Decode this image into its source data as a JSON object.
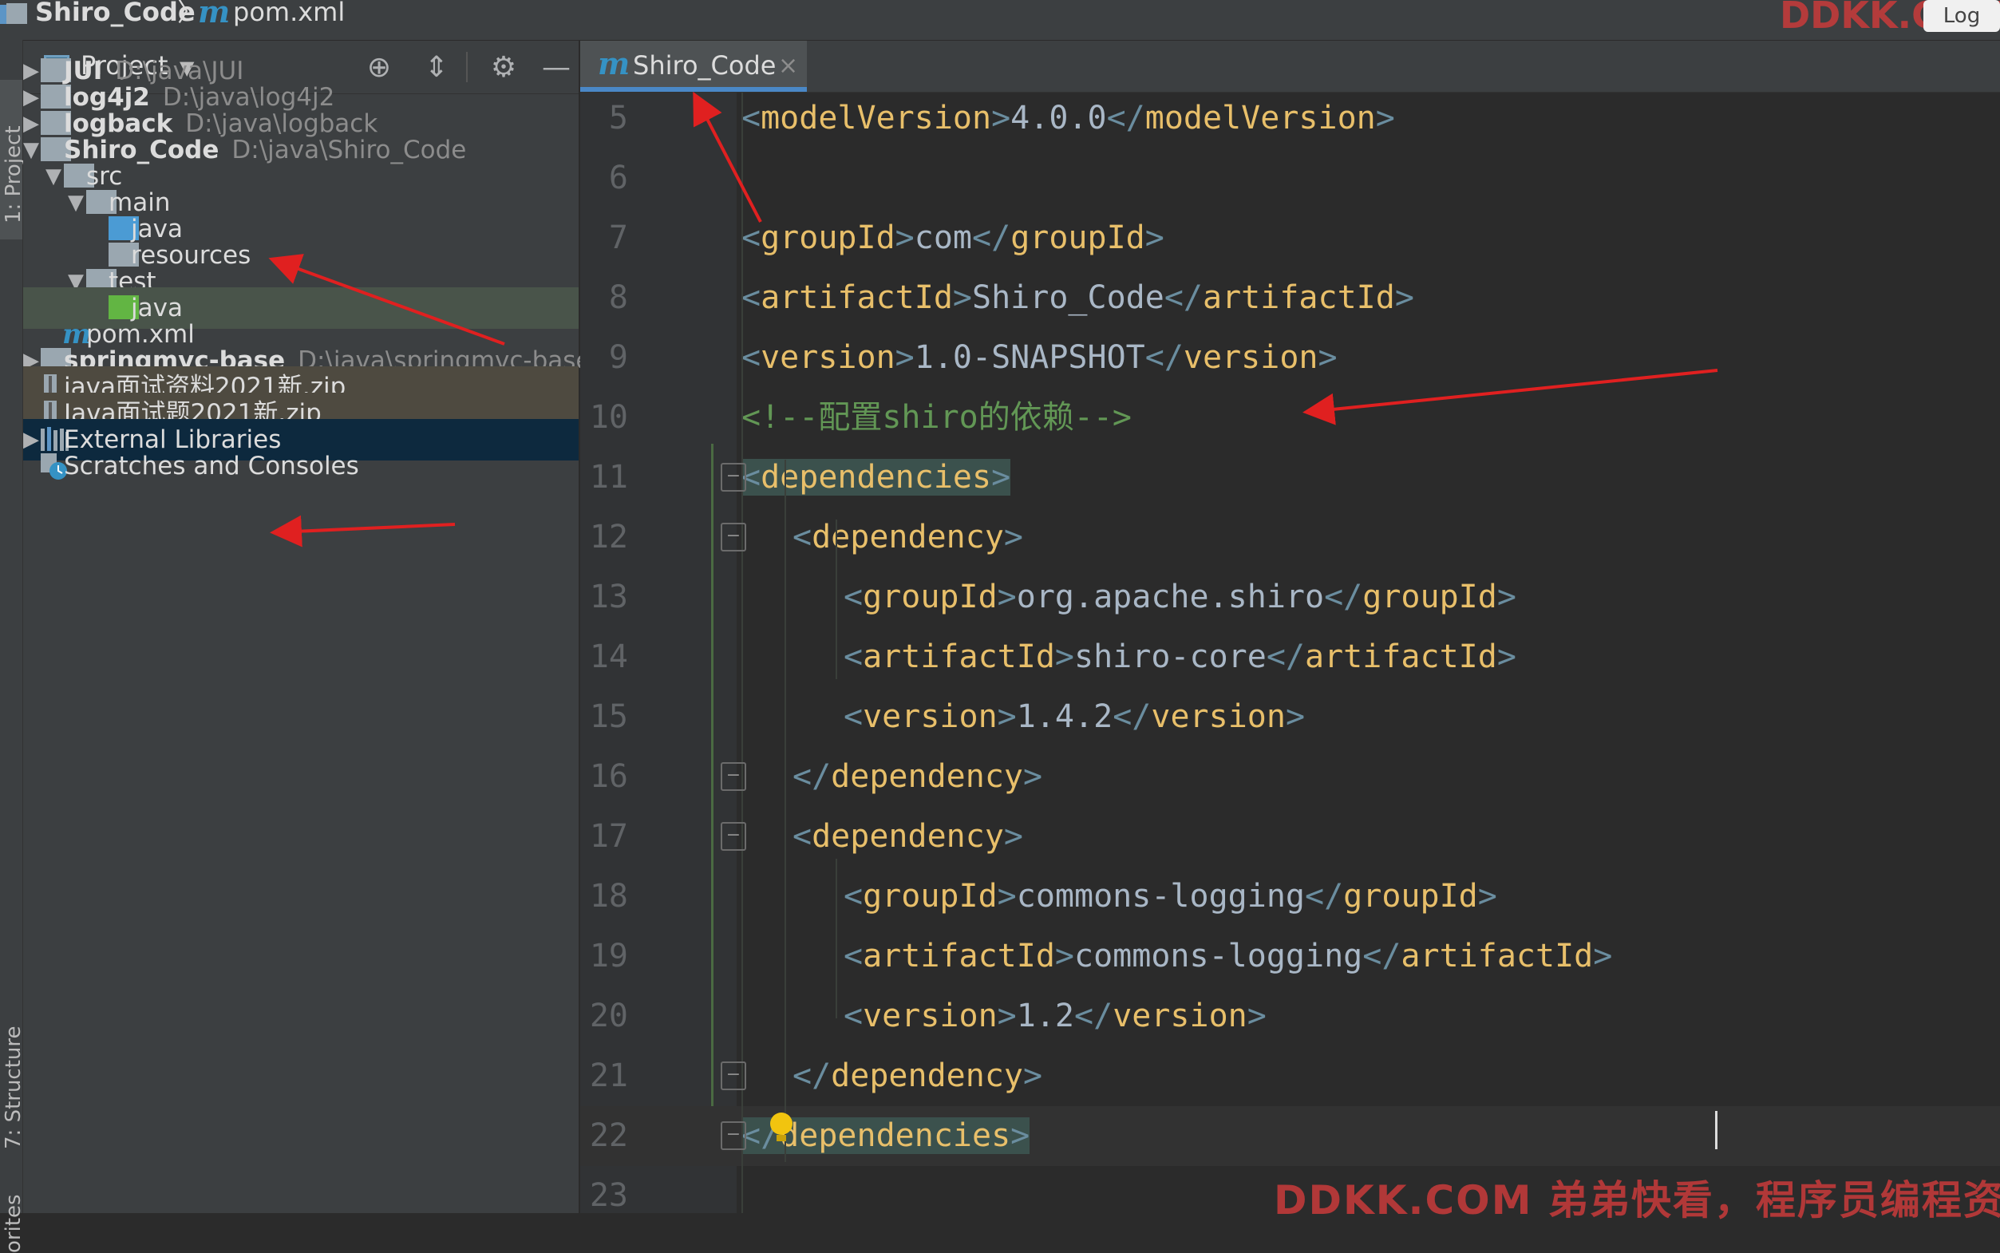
{
  "breadcrumb": {
    "project": "Shiro_Code",
    "separator": "〉",
    "file": "pom.xml"
  },
  "left_strip": {
    "project_tab": "1: Project",
    "structure_tab": "7: Structure",
    "favorites_tab": "orites"
  },
  "project_panel": {
    "title": "Project"
  },
  "tree": [
    {
      "label": "JUI",
      "path": "D:\\java\\JUI"
    },
    {
      "label": "log4j2",
      "path": "D:\\java\\log4j2"
    },
    {
      "label": "logback",
      "path": "D:\\java\\logback"
    },
    {
      "label": "Shiro_Code",
      "path": "D:\\java\\Shiro_Code"
    },
    {
      "label": "src"
    },
    {
      "label": "main"
    },
    {
      "label": "java"
    },
    {
      "label": "resources"
    },
    {
      "label": "test"
    },
    {
      "label": "java"
    },
    {
      "label": "pom.xml"
    },
    {
      "label": "springmvc-base",
      "path": "D:\\java\\springmvc-base"
    },
    {
      "label": "java面试资料2021新.zip"
    },
    {
      "label": "Java面试题2021新.zip"
    },
    {
      "label": "External Libraries"
    },
    {
      "label": "Scratches and Consoles"
    }
  ],
  "editor": {
    "tab_label": "Shiro_Code",
    "lines": [
      {
        "n": "5",
        "tag": "modelVersion",
        "text": "4.0.0"
      },
      {
        "n": "6"
      },
      {
        "n": "7",
        "tag": "groupId",
        "text": "com"
      },
      {
        "n": "8",
        "tag": "artifactId",
        "text": "Shiro_Code"
      },
      {
        "n": "9",
        "tag": "version",
        "text": "1.0-SNAPSHOT"
      },
      {
        "n": "10",
        "comment": "<!--配置shiro的依赖-->"
      },
      {
        "n": "11",
        "open": "dependencies"
      },
      {
        "n": "12",
        "open": "dependency"
      },
      {
        "n": "13",
        "tag": "groupId",
        "text": "org.apache.shiro"
      },
      {
        "n": "14",
        "tag": "artifactId",
        "text": "shiro-core"
      },
      {
        "n": "15",
        "tag": "version",
        "text": "1.4.2"
      },
      {
        "n": "16",
        "close": "dependency"
      },
      {
        "n": "17",
        "open": "dependency"
      },
      {
        "n": "18",
        "tag": "groupId",
        "text": "commons-logging"
      },
      {
        "n": "19",
        "tag": "artifactId",
        "text": "commons-logging"
      },
      {
        "n": "20",
        "tag": "version",
        "text": "1.2"
      },
      {
        "n": "21",
        "close": "dependency"
      },
      {
        "n": "22",
        "close": "dependencies"
      },
      {
        "n": "23"
      }
    ]
  },
  "watermark": {
    "bottom": "DDKK.COM 弟弟快看，程序员编程资料站",
    "top": "DDKK.COM",
    "top_box": "Log"
  },
  "colors": {
    "tag": "#e8bf6a",
    "bracket": "#6a8d9f",
    "text": "#a9b7c6",
    "comment": "#629755",
    "arrow": "#e02020"
  }
}
